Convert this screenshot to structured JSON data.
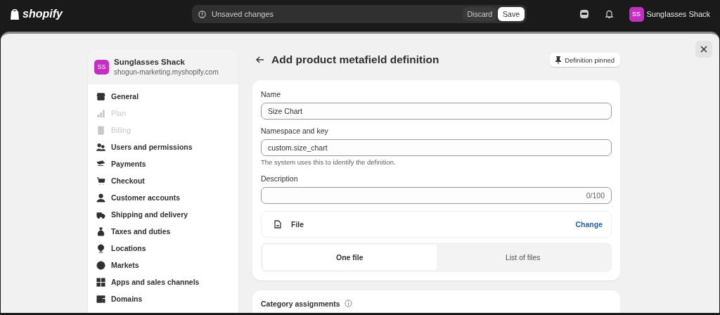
{
  "topbar": {
    "logo": "shopify",
    "notice": "Unsaved changes",
    "discard": "Discard",
    "save": "Save",
    "store_initials": "SS",
    "store_name": "Sunglasses Shack"
  },
  "sidebar": {
    "store_initials": "SS",
    "store_name": "Sunglasses Shack",
    "store_domain": "shogun-marketing.myshopify.com",
    "items": [
      {
        "label": "General",
        "disabled": false
      },
      {
        "label": "Plan",
        "disabled": true
      },
      {
        "label": "Billing",
        "disabled": true
      },
      {
        "label": "Users and permissions",
        "disabled": false
      },
      {
        "label": "Payments",
        "disabled": false
      },
      {
        "label": "Checkout",
        "disabled": false
      },
      {
        "label": "Customer accounts",
        "disabled": false
      },
      {
        "label": "Shipping and delivery",
        "disabled": false
      },
      {
        "label": "Taxes and duties",
        "disabled": false
      },
      {
        "label": "Locations",
        "disabled": false
      },
      {
        "label": "Markets",
        "disabled": false
      },
      {
        "label": "Apps and sales channels",
        "disabled": false
      },
      {
        "label": "Domains",
        "disabled": false
      }
    ]
  },
  "page": {
    "title": "Add product metafield definition",
    "pinned_button": "Definition pinned"
  },
  "form": {
    "name_label": "Name",
    "name_value": "Size Chart",
    "key_label": "Namespace and key",
    "key_value": "custom.size_chart",
    "key_help": "The system uses this to identify the definition.",
    "description_label": "Description",
    "description_count": "0/100",
    "type_label": "File",
    "change_link": "Change",
    "options": [
      {
        "label": "One file",
        "selected": true
      },
      {
        "label": "List of files",
        "selected": false
      }
    ]
  },
  "category": {
    "title": "Category assignments"
  }
}
